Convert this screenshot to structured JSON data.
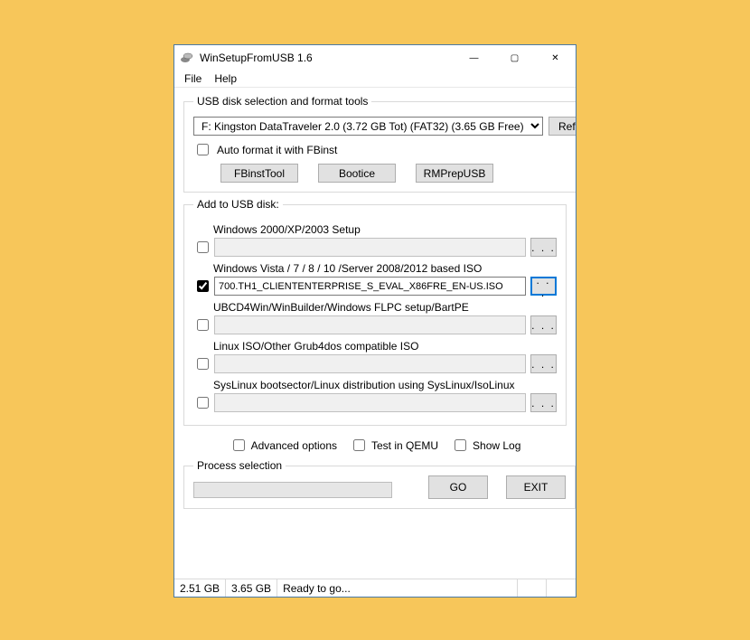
{
  "window": {
    "title": "WinSetupFromUSB 1.6"
  },
  "controls": {
    "minimize": "—",
    "maximize": "▢",
    "close": "✕"
  },
  "menu": {
    "file": "File",
    "help": "Help"
  },
  "disk_group": {
    "legend": "USB disk selection and format tools",
    "selected": "F: Kingston DataTraveler 2.0 (3.72 GB Tot) (FAT32) (3.65 GB Free)",
    "refresh": "Refresh",
    "autofmt": "Auto format it with FBinst",
    "tools": {
      "fbinst": "FBinstTool",
      "bootice": "Bootice",
      "rmprep": "RMPrepUSB"
    }
  },
  "add_group": {
    "legend": "Add to USB disk:",
    "browse": ". . .",
    "rows": {
      "win2k": {
        "label": "Windows 2000/XP/2003 Setup",
        "checked": false,
        "value": ""
      },
      "winvista": {
        "label": "Windows Vista / 7 / 8 / 10 /Server 2008/2012 based ISO",
        "checked": true,
        "value": "700.TH1_CLIENTENTERPRISE_S_EVAL_X86FRE_EN-US.ISO"
      },
      "ubcd": {
        "label": "UBCD4Win/WinBuilder/Windows FLPC setup/BartPE",
        "checked": false,
        "value": ""
      },
      "linux": {
        "label": "Linux ISO/Other Grub4dos compatible ISO",
        "checked": false,
        "value": ""
      },
      "syslinux": {
        "label": "SysLinux bootsector/Linux distribution using SysLinux/IsoLinux",
        "checked": false,
        "value": ""
      }
    }
  },
  "opts": {
    "adv": "Advanced options",
    "qemu": "Test in QEMU",
    "log": "Show Log"
  },
  "process": {
    "legend": "Process selection",
    "go": "GO",
    "exit": "EXIT"
  },
  "status": {
    "used": "2.51 GB",
    "total": "3.65 GB",
    "msg": "Ready to go..."
  }
}
